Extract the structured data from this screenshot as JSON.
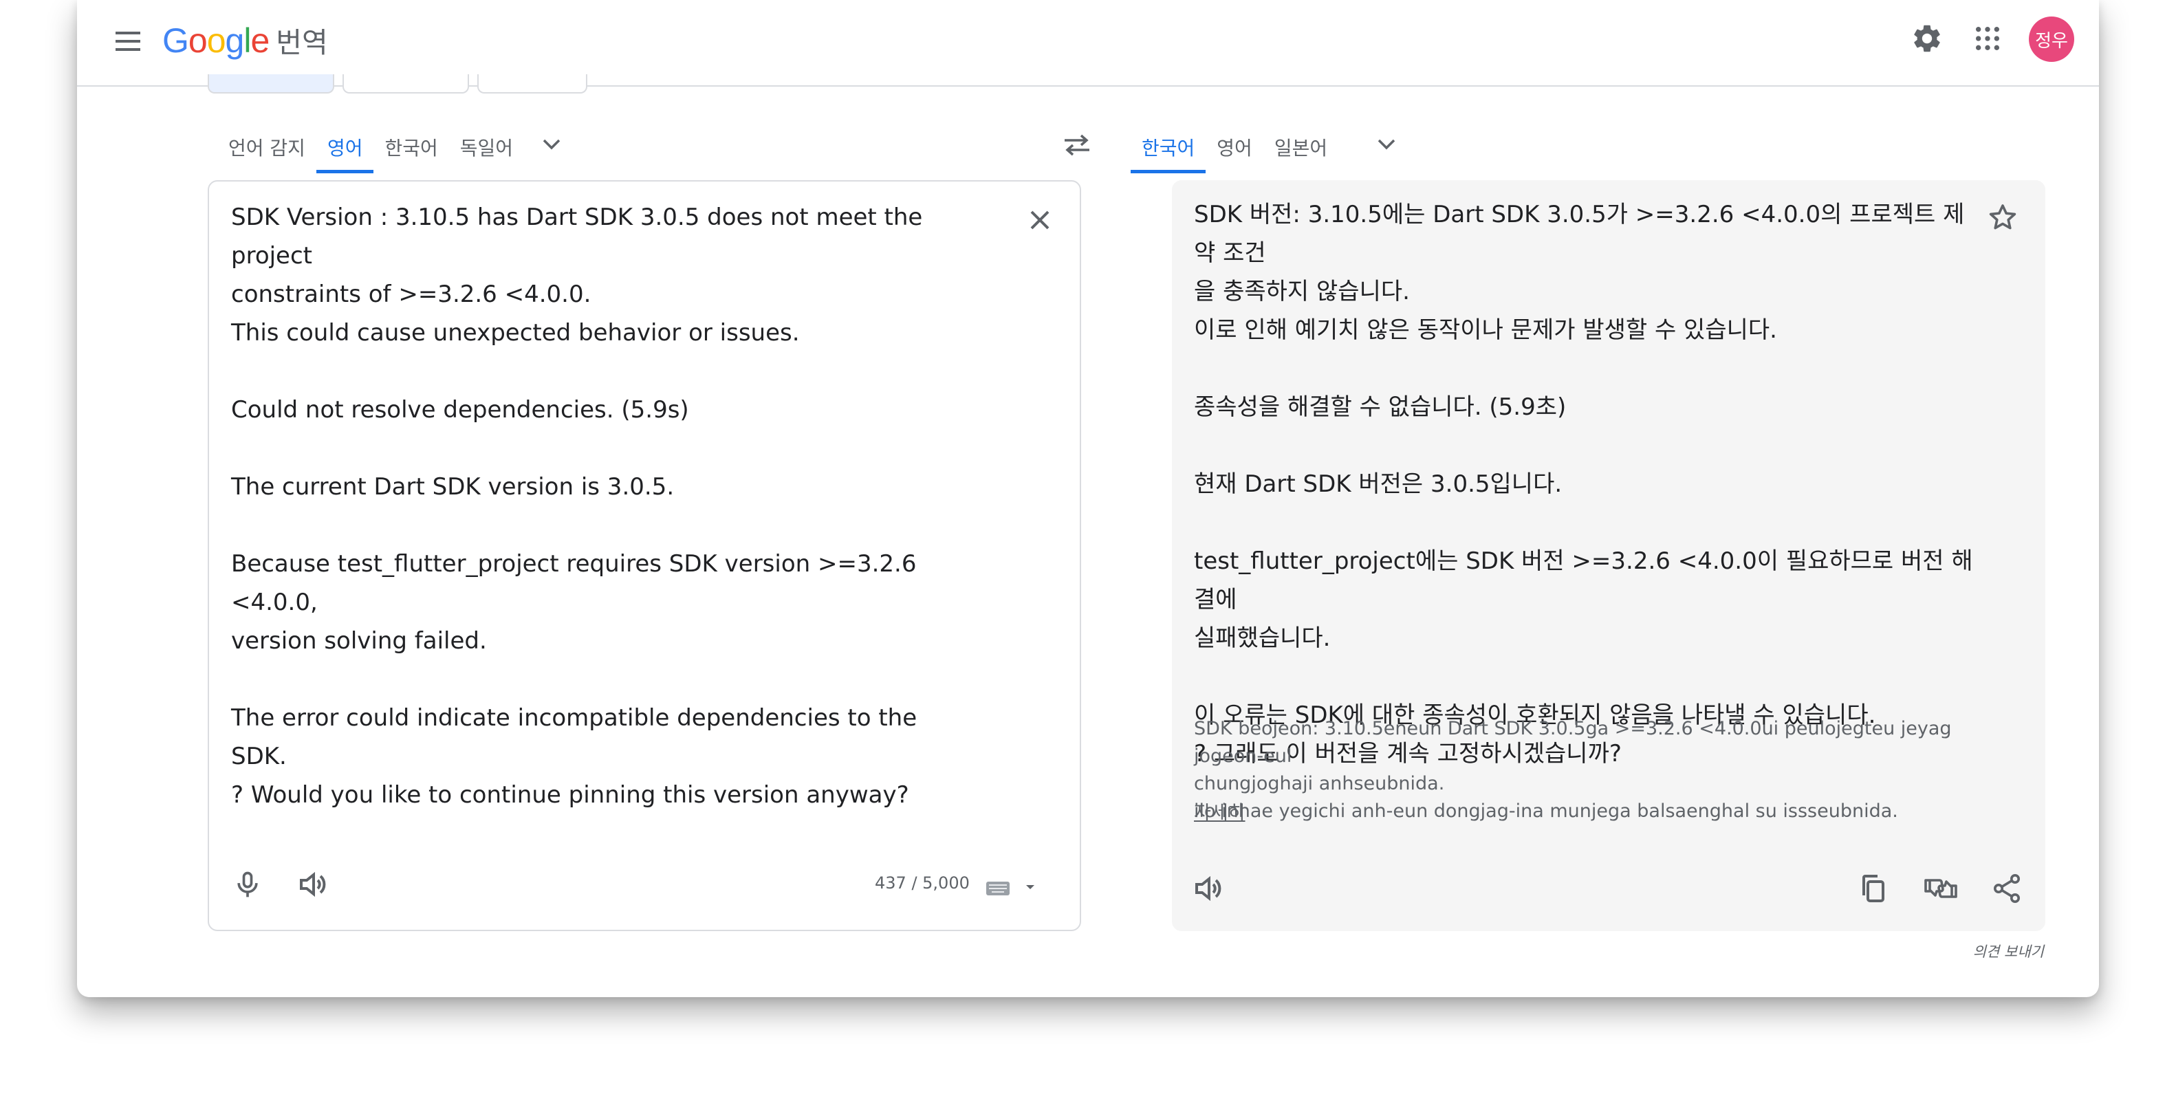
{
  "header": {
    "logo_text": "Google",
    "product_name": "번역",
    "avatar_text": "정우",
    "icons": [
      "menu-icon",
      "gear-icon",
      "apps-grid-icon"
    ]
  },
  "source": {
    "tabs": [
      "언어 감지",
      "영어",
      "한국어",
      "독일어"
    ],
    "active_tab": "영어",
    "text": "SDK Version : 3.10.5 has Dart SDK 3.0.5 does not meet the project\nconstraints of >=3.2.6 <4.0.0.\nThis could cause unexpected behavior or issues.\n\nCould not resolve dependencies. (5.9s)\n\nThe current Dart SDK version is 3.0.5.\n\nBecause test_flutter_project requires SDK version >=3.2.6 <4.0.0,\nversion solving failed.\n\nThe error could indicate incompatible dependencies to the SDK.\n? Would you like to continue pinning this version anyway?",
    "char_count": "437 / 5,000"
  },
  "target": {
    "tabs": [
      "한국어",
      "영어",
      "일본어"
    ],
    "active_tab": "한국어",
    "text": "SDK 버전: 3.10.5에는 Dart SDK 3.0.5가 >=3.2.6 <4.0.0의 프로젝트 제약 조건\n을 충족하지 않습니다.\n이로 인해 예기치 않은 동작이나 문제가 발생할 수 있습니다.\n\n종속성을 해결할 수 없습니다. (5.9초)\n\n현재 Dart SDK 버전은 3.0.5입니다.\n\ntest_flutter_project에는 SDK 버전 >=3.2.6 <4.0.0이 필요하므로 버전 해결에\n실패했습니다.\n\n이 오류는 SDK에 대한 종속성이 호환되지 않음을 나타낼 수 있습니다.\n? 그래도 이 버전을 계속 고정하시겠습니까?",
    "romanization": "SDK beojeon: 3.10.5eneun Dart SDK 3.0.5ga >=3.2.6 <4.0.0ui peulojegteu jeyag jogeon-eul\nchungjoghaji anhseubnida.\nilo inhae yegichi anh-eun dongjag-ina munjega balsaenghal su issseubnida.",
    "more_label": "자세히"
  },
  "footer": {
    "feedback_label": "의견 보내기"
  },
  "colors": {
    "accent": "#1a73e8",
    "avatar_bg": "#e8487c",
    "logo": [
      "#4285F4",
      "#EA4335",
      "#FBBC05",
      "#4285F4",
      "#34A853",
      "#EA4335"
    ]
  }
}
